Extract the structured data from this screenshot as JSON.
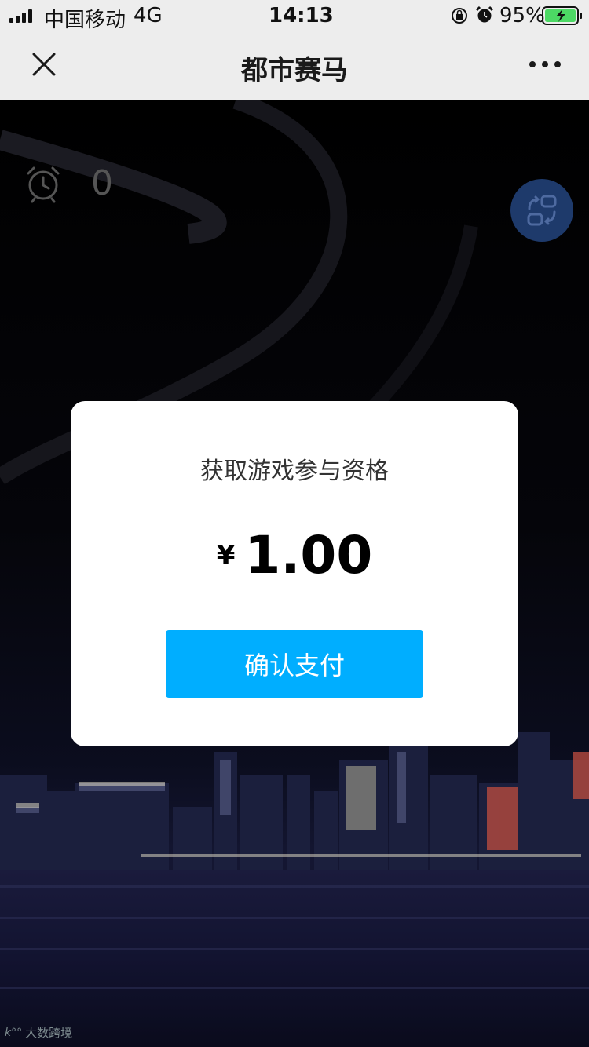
{
  "status_bar": {
    "carrier": "中国移动",
    "network": "4G",
    "time": "14:13",
    "battery": "95%"
  },
  "nav": {
    "title": "都市赛马",
    "close_icon": "close-icon",
    "more_icon": "more-icon"
  },
  "game": {
    "timer_value": "0",
    "watermark": "大数跨境"
  },
  "dialog": {
    "title": "获取游戏参与资格",
    "currency": "¥",
    "amount": "1.00",
    "pay_button": "确认支付"
  },
  "colors": {
    "accent": "#00aeff",
    "switch_button": "#1e3a6b",
    "battery_green": "#4cd964"
  }
}
